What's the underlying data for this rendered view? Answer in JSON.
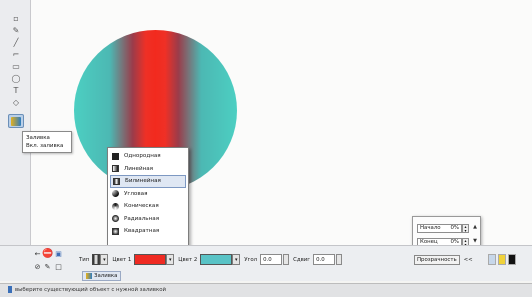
{
  "tooltip": {
    "title": "Заливка",
    "subtitle": "Вкл. заливка"
  },
  "fill_menu": {
    "items": [
      {
        "label": "Однородная",
        "icon": "uniform-fill-icon"
      },
      {
        "label": "Линейная",
        "icon": "linear-fill-icon"
      },
      {
        "label": "Билинейная",
        "icon": "bilinear-fill-icon",
        "selected": true
      },
      {
        "label": "Угловая",
        "icon": "corner-fill-icon"
      },
      {
        "label": "Коническая",
        "icon": "conical-fill-icon"
      },
      {
        "label": "Радиальная",
        "icon": "radial-fill-icon"
      },
      {
        "label": "Квадратная",
        "icon": "square-fill-icon"
      }
    ]
  },
  "property_bar": {
    "type_label": "Тип",
    "color1_label": "Цвет 1",
    "color1": "#ef2a22",
    "color2_label": "Цвет 2",
    "color2": "#59c3c6",
    "angle_label": "Угол",
    "angle_value": "0.0",
    "shift_label": "Сдвиг",
    "shift_value": "0.0",
    "transparency_label": "Прозрачность",
    "collapse": "<<",
    "object_tab": "Заливка"
  },
  "transparency_popup": {
    "start_label": "Начало",
    "start_value": "0%",
    "end_label": "Конец",
    "end_value": "0%"
  },
  "status_bar": {
    "text": "выберите существующий объект с нужной заливкой"
  },
  "circle_gradient": [
    "#4ccfc2",
    "#ef3026",
    "#4ccfc2"
  ]
}
